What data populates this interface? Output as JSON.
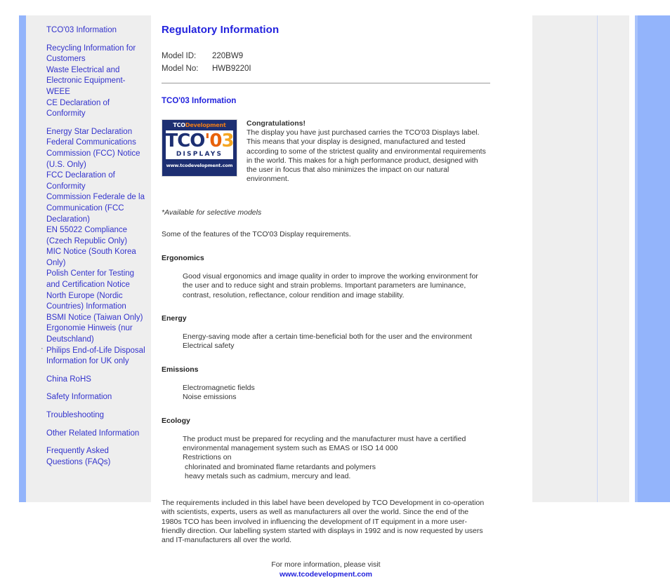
{
  "sidebar": {
    "groups": [
      {
        "items": [
          {
            "label": "TCO'03 Information",
            "dot": false
          }
        ]
      },
      {
        "items": [
          {
            "label": "Recycling Information for Customers",
            "dot": false
          },
          {
            "label": "Waste Electrical and Electronic Equipment-WEEE",
            "dot": false
          },
          {
            "label": "CE Declaration of Conformity",
            "dot": false
          }
        ]
      },
      {
        "items": [
          {
            "label": "Energy Star Declaration",
            "dot": false
          },
          {
            "label": "Federal Communications Commission (FCC) Notice (U.S. Only)",
            "dot": false
          },
          {
            "label": "FCC Declaration of Conformity",
            "dot": false
          },
          {
            "label": "Commission Federale de la Communication (FCC Declaration)",
            "dot": false
          },
          {
            "label": "EN 55022 Compliance (Czech Republic Only)",
            "dot": false
          },
          {
            "label": "MIC Notice (South Korea Only)",
            "dot": false
          },
          {
            "label": "Polish Center for Testing and Certification Notice",
            "dot": false
          },
          {
            "label": "North Europe (Nordic Countries) Information",
            "dot": false
          },
          {
            "label": "BSMI Notice (Taiwan Only)",
            "dot": false
          },
          {
            "label": "Ergonomie Hinweis (nur Deutschland)",
            "dot": false
          },
          {
            "label": "Philips End-of-Life Disposal",
            "dot": true
          },
          {
            "label": "Information for UK only",
            "dot": false
          }
        ]
      },
      {
        "items": [
          {
            "label": "China RoHS",
            "dot": false
          }
        ]
      },
      {
        "items": [
          {
            "label": "Safety Information",
            "dot": false
          }
        ]
      },
      {
        "items": [
          {
            "label": "Troubleshooting",
            "dot": false
          }
        ]
      },
      {
        "items": [
          {
            "label": "Other Related Information",
            "dot": false
          }
        ]
      },
      {
        "items": [
          {
            "label": "Frequently Asked Questions (FAQs)",
            "dot": false
          }
        ]
      }
    ]
  },
  "main": {
    "page_title": "Regulatory Information",
    "model": {
      "id_label": "Model ID:",
      "id_value": "220BW9",
      "no_label": "Model No:",
      "no_value": "HWB9220I"
    },
    "section_title": "TCO'03 Information",
    "logo": {
      "dev_tco": "TCO",
      "dev_development": "Development",
      "main_tco": "TCO",
      "main_apos": "'0",
      "main_3": "3",
      "displays": "DISPLAYS",
      "url": "www.tcodevelopment.com"
    },
    "congratulations_heading": "Congratulations!",
    "congratulations_body": "The display you have just purchased carries the TCO'03 Displays label. This means that your display is designed, manufactured and tested according to some of the strictest quality and environmental requirements in the world. This makes for a high performance product, designed with the user in focus that also minimizes the impact on our natural environment.",
    "available_note": "*Available for selective models",
    "features_intro": "Some of the features of the TCO'03 Display requirements.",
    "sections": [
      {
        "heading": "Ergonomics",
        "body": "Good visual ergonomics and image quality in order to improve the working environment for the user and to reduce sight and strain problems. Important parameters are luminance, contrast, resolution, reflectance, colour rendition and image stability."
      },
      {
        "heading": "Energy",
        "body": "Energy-saving mode after a certain time-beneficial both for the user and the environment",
        "body2": "Electrical safety"
      },
      {
        "heading": "Emissions",
        "body": "Electromagnetic fields",
        "body2": "Noise emissions"
      },
      {
        "heading": "Ecology",
        "body": "The product must be prepared for recycling and the manufacturer must have a certified environmental management system such as EMAS or ISO 14 000",
        "body2": "Restrictions on",
        "sub_items": [
          "chlorinated and brominated flame retardants and polymers",
          "heavy metals such as cadmium, mercury and lead."
        ]
      }
    ],
    "closing_paragraph": "The requirements included in this label have been developed by TCO Development in co-operation with scientists, experts, users as well as manufacturers all over the world. Since the end of the 1980s TCO has been involved in influencing the development of IT equipment in a more user-friendly direction. Our labelling system started with displays in 1992 and is now requested by users and IT-manufacturers all over the world.",
    "footer_text": "For more information, please visit",
    "footer_link": "www.tcodevelopment.com"
  },
  "colors": {
    "link": "#3333cc",
    "heading": "#2222dd",
    "panel": "#eeeeee",
    "accent_bar": "#93b4fb",
    "logo_navy": "#1d2f72",
    "logo_orange": "#e8620a",
    "logo_amber": "#f5a623"
  }
}
